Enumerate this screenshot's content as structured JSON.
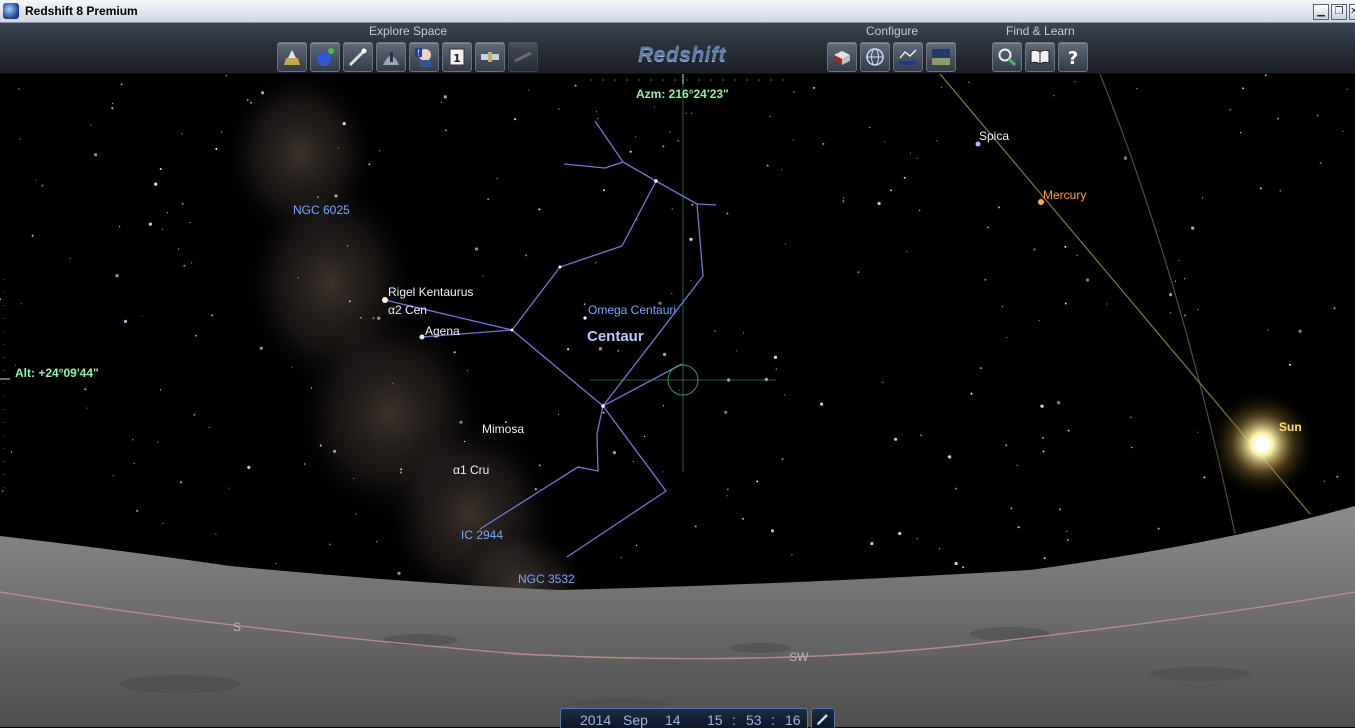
{
  "window": {
    "title": "Redshift 8 Premium"
  },
  "toolbar": {
    "groups": {
      "explore": "Explore Space",
      "configure": "Configure",
      "find": "Find & Learn"
    },
    "brand": "Redshift",
    "help_glyph": "?"
  },
  "view": {
    "azimuth": "Azm: 216°24'23\"",
    "altitude": "Alt: +24°09'44\""
  },
  "sky_labels": {
    "ngc6025": "NGC 6025",
    "rigel": "Rigel Kentaurus",
    "a2cen": "α2 Cen",
    "agena": "Agena",
    "omega": "Omega Centauri",
    "centaur": "Centaur",
    "mimosa": "Mimosa",
    "a1cru": "α1 Cru",
    "ic2944": "IC 2944",
    "ngc3532": "NGC 3532",
    "spica": "Spica",
    "mercury": "Mercury",
    "sun": "Sun"
  },
  "compass": {
    "s": "S",
    "sw": "SW"
  },
  "datetime": {
    "year": "2014",
    "month": "Sep",
    "day": "14",
    "hour": "15",
    "minute": "53",
    "second": "16",
    "sep": ":"
  },
  "icons": {
    "explore": [
      "observatory-icon",
      "planet-icon",
      "comet-icon",
      "telescope-dome-icon",
      "astronaut-info-icon",
      "calendar-day-icon",
      "space-probe-icon",
      "spacecraft-icon"
    ],
    "configure": [
      "book-settings-icon",
      "globe-grid-icon",
      "constellation-display-icon",
      "landscape-horizon-icon"
    ],
    "find": [
      "magnifier-icon",
      "open-book-icon",
      "help-icon"
    ]
  },
  "colors": {
    "constellation_lines": "#6e7ad6",
    "ecliptic": "#b9b33a",
    "horizon_line": "#b98a8a",
    "sun_glow": "#fff3b0",
    "crosshair": "#3aa85a"
  }
}
